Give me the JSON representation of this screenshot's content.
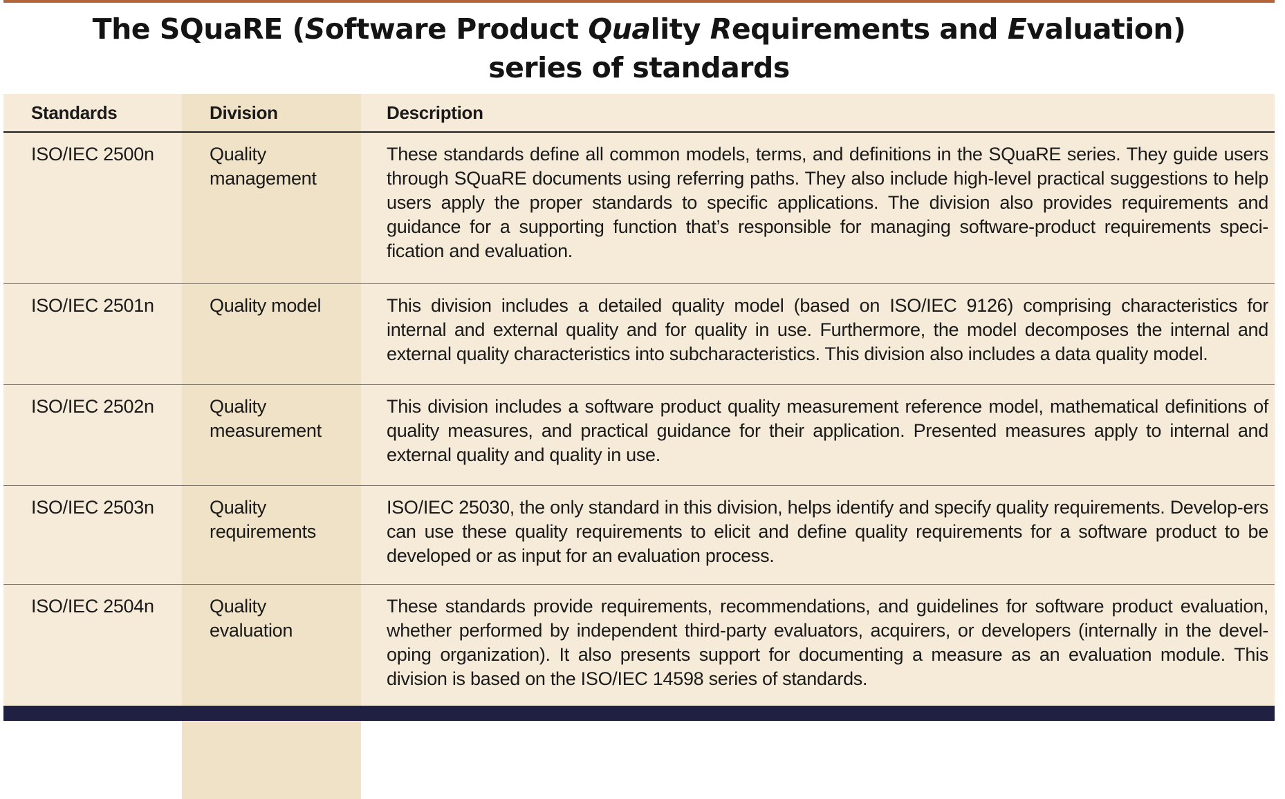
{
  "title": {
    "line1_a": "The SQuaRE (",
    "line1_S": "S",
    "line1_b": "oftware Product ",
    "line1_Qua": "Qua",
    "line1_c": "lity ",
    "line1_R": "R",
    "line1_d": "equirements and ",
    "line1_E": "E",
    "line1_e": "valuation)",
    "line2": "series of standards"
  },
  "table": {
    "headers": {
      "standards": "Standards",
      "division": "Division",
      "description": "Description"
    },
    "rows": [
      {
        "standard": "ISO/IEC 2500n",
        "division_l1": "Quality",
        "division_l2": "management",
        "description": "These standards define all common models, terms, and definitions in the SQuaRE series. They guide users through SQuaRE documents using referring paths. They also include high-level practical suggestions to help users apply the proper standards to specific applications. The division also provides requirements and guidance for a supporting function that’s responsible for managing software-product requirements speci-fication and evaluation."
      },
      {
        "standard": "ISO/IEC 2501n",
        "division_l1": "Quality model",
        "division_l2": "",
        "description": "This division includes a detailed quality model (based on ISO/IEC 9126) comprising characteristics for internal and external quality and for quality in use. Furthermore, the model decomposes the internal and external quality characteristics into subcharacteristics. This division also includes a data quality model."
      },
      {
        "standard": "ISO/IEC 2502n",
        "division_l1": "Quality",
        "division_l2": "measurement",
        "description": "This division includes a software product quality measurement reference model, mathematical definitions of quality measures, and practical guidance for their application. Presented measures apply to internal and external quality and quality in use."
      },
      {
        "standard": "ISO/IEC 2503n",
        "division_l1": "Quality",
        "division_l2": "requirements",
        "description": "ISO/IEC 25030, the only standard in this division, helps identify and specify quality requirements. Develop-ers can use these quality requirements to elicit and define quality requirements for a software product to be developed or as input for an evaluation process."
      },
      {
        "standard": "ISO/IEC 2504n",
        "division_l1": "Quality",
        "division_l2": "evaluation",
        "description": "These standards provide requirements, recommendations, and guidelines for software product evaluation, whether performed by independent third-party evaluators, acquirers, or developers (internally in the devel-oping organization). It also presents support for documenting a measure as an evaluation module. This division is based on the ISO/IEC 14598 series of standards."
      }
    ]
  },
  "colors": {
    "accent_rule": "#b5653a",
    "table_bg": "#f6ebd9",
    "division_band": "#f0e2c6",
    "footer_band": "#1f2042"
  }
}
